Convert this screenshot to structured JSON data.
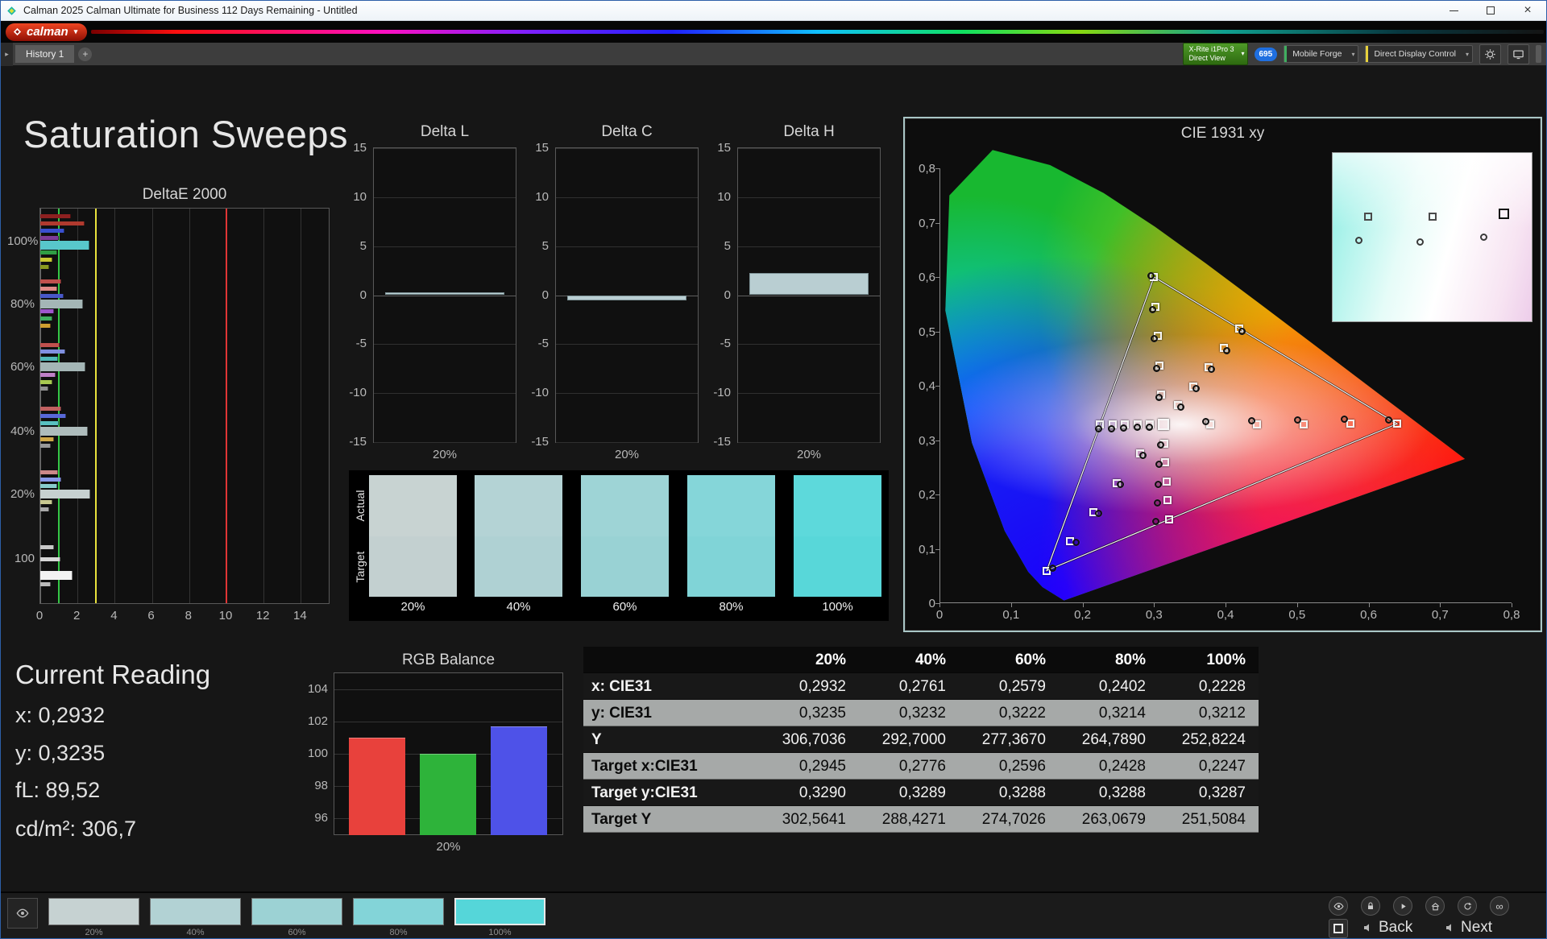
{
  "window": {
    "title": "Calman 2025 Calman Ultimate for Business 112 Days Remaining  - Untitled"
  },
  "brand": {
    "logo_text": "calman"
  },
  "toolbar": {
    "history_tab": "History 1",
    "meter": {
      "line1": "X-Rite i1Pro 3",
      "line2": "Direct View"
    },
    "badge": "695",
    "source": "Mobile Forge",
    "display": "Direct Display Control"
  },
  "page": {
    "title": "Saturation Sweeps"
  },
  "reading": {
    "title": "Current Reading",
    "lines": [
      "x: 0,2932",
      "y: 0,3235",
      "fL: 89,52",
      "cd/m²: 306,7"
    ]
  },
  "swatches": {
    "row_labels": [
      "Actual",
      "Target"
    ],
    "items": [
      {
        "label": "20%",
        "actual": "#c8d3d2",
        "target": "#c3d0d0"
      },
      {
        "label": "40%",
        "actual": "#b4d3d5",
        "target": "#afd1d3"
      },
      {
        "label": "60%",
        "actual": "#9ed4d6",
        "target": "#99d2d4"
      },
      {
        "label": "80%",
        "actual": "#85d6d9",
        "target": "#80d4d7"
      },
      {
        "label": "100%",
        "actual": "#5dd9db",
        "target": "#58d7d9"
      }
    ]
  },
  "table": {
    "headers": [
      "",
      "20%",
      "40%",
      "60%",
      "80%",
      "100%"
    ],
    "rows": [
      {
        "label": "x: CIE31",
        "values": [
          "0,2932",
          "0,2761",
          "0,2579",
          "0,2402",
          "0,2228"
        ]
      },
      {
        "label": "y: CIE31",
        "values": [
          "0,3235",
          "0,3232",
          "0,3222",
          "0,3214",
          "0,3212"
        ]
      },
      {
        "label": "Y",
        "values": [
          "306,7036",
          "292,7000",
          "277,3670",
          "264,7890",
          "252,8224"
        ]
      },
      {
        "label": "Target x:CIE31",
        "values": [
          "0,2945",
          "0,2776",
          "0,2596",
          "0,2428",
          "0,2247"
        ]
      },
      {
        "label": "Target y:CIE31",
        "values": [
          "0,3290",
          "0,3289",
          "0,3288",
          "0,3288",
          "0,3287"
        ]
      },
      {
        "label": "Target Y",
        "values": [
          "302,5641",
          "288,4271",
          "274,7026",
          "263,0679",
          "251,5084"
        ]
      }
    ]
  },
  "bottom": {
    "back": "Back",
    "next": "Next",
    "thumbnails": [
      {
        "label": "20%",
        "color": "#c6d2d2"
      },
      {
        "label": "40%",
        "color": "#b2d2d4"
      },
      {
        "label": "60%",
        "color": "#9cd2d4"
      },
      {
        "label": "80%",
        "color": "#83d4d8"
      },
      {
        "label": "100%",
        "color": "#55d6d9",
        "selected": true
      }
    ]
  },
  "chart_data": {
    "deltae2000": {
      "type": "bar",
      "title": "DeltaE 2000",
      "x_ticks": [
        0,
        2,
        4,
        6,
        8,
        10,
        12,
        14
      ],
      "x_max": 15.5,
      "y_groups": [
        "100%",
        "80%",
        "60%",
        "40%",
        "20%",
        "100"
      ],
      "group_fracs": [
        0.085,
        0.245,
        0.405,
        0.5675,
        0.7275,
        0.89
      ],
      "ref_lines": [
        {
          "v": 1,
          "color": "#35c746"
        },
        {
          "v": 3,
          "color": "#e8e23c"
        },
        {
          "v": 10,
          "color": "#e03535"
        }
      ],
      "bars": [
        {
          "y": 0.02,
          "v": 1.6,
          "c": "#8e2020"
        },
        {
          "y": 0.038,
          "v": 2.35,
          "c": "#b03a2e"
        },
        {
          "y": 0.056,
          "v": 1.25,
          "c": "#3a50d0"
        },
        {
          "y": 0.074,
          "v": 0.95,
          "c": "#7d3c98"
        },
        {
          "y": 0.092,
          "v": 2.6,
          "c": "#58c7cb",
          "t": 1
        },
        {
          "y": 0.112,
          "v": 0.85,
          "c": "#2f9e44"
        },
        {
          "y": 0.13,
          "v": 0.6,
          "c": "#c8c832"
        },
        {
          "y": 0.148,
          "v": 0.45,
          "c": "#8a9a20"
        },
        {
          "y": 0.185,
          "v": 1.1,
          "c": "#c0504d"
        },
        {
          "y": 0.203,
          "v": 0.85,
          "c": "#e08a87"
        },
        {
          "y": 0.221,
          "v": 1.2,
          "c": "#4858c8"
        },
        {
          "y": 0.241,
          "v": 2.25,
          "c": "#a4b6b6",
          "t": 1
        },
        {
          "y": 0.261,
          "v": 0.7,
          "c": "#9e55cc"
        },
        {
          "y": 0.279,
          "v": 0.6,
          "c": "#3fae5f"
        },
        {
          "y": 0.297,
          "v": 0.5,
          "c": "#cf9f30"
        },
        {
          "y": 0.345,
          "v": 1.0,
          "c": "#c0504d"
        },
        {
          "y": 0.363,
          "v": 1.3,
          "c": "#8090e0"
        },
        {
          "y": 0.381,
          "v": 0.9,
          "c": "#50b8b8"
        },
        {
          "y": 0.401,
          "v": 2.4,
          "c": "#a4b6b6",
          "t": 1
        },
        {
          "y": 0.421,
          "v": 0.8,
          "c": "#c080c8"
        },
        {
          "y": 0.439,
          "v": 0.6,
          "c": "#a8c850"
        },
        {
          "y": 0.457,
          "v": 0.4,
          "c": "#909090"
        },
        {
          "y": 0.508,
          "v": 1.1,
          "c": "#c06060"
        },
        {
          "y": 0.526,
          "v": 1.35,
          "c": "#5868d8"
        },
        {
          "y": 0.544,
          "v": 0.95,
          "c": "#58c0c0"
        },
        {
          "y": 0.564,
          "v": 2.5,
          "c": "#aebcbc",
          "t": 1
        },
        {
          "y": 0.584,
          "v": 0.7,
          "c": "#d0a848"
        },
        {
          "y": 0.602,
          "v": 0.5,
          "c": "#989898"
        },
        {
          "y": 0.668,
          "v": 0.9,
          "c": "#cc8888"
        },
        {
          "y": 0.686,
          "v": 1.1,
          "c": "#8898e8"
        },
        {
          "y": 0.704,
          "v": 0.85,
          "c": "#88cccc"
        },
        {
          "y": 0.724,
          "v": 2.65,
          "c": "#c6d0d0",
          "t": 1
        },
        {
          "y": 0.744,
          "v": 0.6,
          "c": "#c8c890"
        },
        {
          "y": 0.762,
          "v": 0.45,
          "c": "#a8a8a8"
        },
        {
          "y": 0.858,
          "v": 0.7,
          "c": "#c8c8c8"
        },
        {
          "y": 0.888,
          "v": 1.05,
          "c": "#d8d8d8"
        },
        {
          "y": 0.93,
          "v": 1.7,
          "c": "#f2f2f2",
          "t": 1
        },
        {
          "y": 0.952,
          "v": 0.5,
          "c": "#bbbbbb"
        }
      ]
    },
    "delta_l": {
      "type": "bar",
      "title": "Delta L",
      "value": 0.3,
      "ticks": [
        15,
        10,
        5,
        0,
        -5,
        -10,
        -15
      ],
      "x_label": "20%"
    },
    "delta_c": {
      "type": "bar",
      "title": "Delta C",
      "value": -0.5,
      "ticks": [
        15,
        10,
        5,
        0,
        -5,
        -10,
        -15
      ],
      "x_label": "20%"
    },
    "delta_h": {
      "type": "bar",
      "title": "Delta H",
      "value": 2.3,
      "ticks": [
        15,
        10,
        5,
        0,
        -5,
        -10,
        -15
      ],
      "x_label": "20%"
    },
    "rgb_balance": {
      "type": "bar",
      "title": "RGB Balance",
      "x_label": "20%",
      "y_ticks": [
        104,
        102,
        100,
        98,
        96
      ],
      "y_range": [
        95,
        105
      ],
      "series": [
        {
          "name": "Red",
          "value": 101.0,
          "color": "#e8413c"
        },
        {
          "name": "Green",
          "value": 100.0,
          "color": "#2eb33a"
        },
        {
          "name": "Blue",
          "value": 101.7,
          "color": "#4e52e8"
        }
      ]
    },
    "cie": {
      "type": "scatter",
      "title": "CIE 1931 xy",
      "x_range": [
        0,
        0.8
      ],
      "y_range": [
        0,
        0.8
      ],
      "x_tick_labels": [
        "0",
        "0,1",
        "0,2",
        "0,3",
        "0,4",
        "0,5",
        "0,6",
        "0,7",
        "0,8"
      ],
      "y_tick_labels": [
        "0",
        "0,1",
        "0,2",
        "0,3",
        "0,4",
        "0,5",
        "0,6",
        "0,7",
        "0,8"
      ],
      "white_point": [
        0.3127,
        0.329
      ],
      "triangle": [
        [
          0.64,
          0.33
        ],
        [
          0.3,
          0.6
        ],
        [
          0.15,
          0.06
        ]
      ],
      "locus": [
        [
          0.1741,
          0.005
        ],
        [
          0.144,
          0.0297
        ],
        [
          0.1241,
          0.0578
        ],
        [
          0.0913,
          0.1327
        ],
        [
          0.0454,
          0.295
        ],
        [
          0.0082,
          0.5384
        ],
        [
          0.0139,
          0.7502
        ],
        [
          0.0743,
          0.8338
        ],
        [
          0.1547,
          0.8059
        ],
        [
          0.2296,
          0.7543
        ],
        [
          0.3016,
          0.6923
        ],
        [
          0.3731,
          0.6245
        ],
        [
          0.4441,
          0.5547
        ],
        [
          0.5125,
          0.4866
        ],
        [
          0.5752,
          0.4242
        ],
        [
          0.627,
          0.3725
        ],
        [
          0.6915,
          0.3083
        ],
        [
          0.7347,
          0.2653
        ]
      ],
      "targets": [
        [
          0.3782,
          0.3292
        ],
        [
          0.4436,
          0.3294
        ],
        [
          0.5091,
          0.3296
        ],
        [
          0.5745,
          0.3298
        ],
        [
          0.64,
          0.33
        ],
        [
          0.3102,
          0.3832
        ],
        [
          0.3076,
          0.4374
        ],
        [
          0.3051,
          0.4916
        ],
        [
          0.3025,
          0.5458
        ],
        [
          0.3,
          0.6
        ],
        [
          0.2802,
          0.2752
        ],
        [
          0.2476,
          0.2214
        ],
        [
          0.2151,
          0.1676
        ],
        [
          0.1825,
          0.1138
        ],
        [
          0.15,
          0.06
        ],
        [
          0.2945,
          0.329
        ],
        [
          0.2776,
          0.3289
        ],
        [
          0.2596,
          0.3288
        ],
        [
          0.2428,
          0.3288
        ],
        [
          0.2247,
          0.3287
        ],
        [
          0.334,
          0.364
        ],
        [
          0.3553,
          0.3992
        ],
        [
          0.3766,
          0.4344
        ],
        [
          0.3979,
          0.4696
        ],
        [
          0.4192,
          0.5048
        ],
        [
          0.3143,
          0.294
        ],
        [
          0.316,
          0.259
        ],
        [
          0.3176,
          0.224
        ],
        [
          0.3193,
          0.189
        ],
        [
          0.3209,
          0.154
        ]
      ],
      "measured": [
        [
          0.2932,
          0.3235
        ],
        [
          0.2761,
          0.3232
        ],
        [
          0.2579,
          0.3222
        ],
        [
          0.2402,
          0.3214
        ],
        [
          0.2228,
          0.3212
        ],
        [
          0.372,
          0.334
        ],
        [
          0.437,
          0.336
        ],
        [
          0.501,
          0.337
        ],
        [
          0.566,
          0.338
        ],
        [
          0.628,
          0.337
        ],
        [
          0.3065,
          0.379
        ],
        [
          0.3035,
          0.432
        ],
        [
          0.3005,
          0.486
        ],
        [
          0.2975,
          0.54
        ],
        [
          0.296,
          0.602
        ],
        [
          0.2845,
          0.272
        ],
        [
          0.2535,
          0.218
        ],
        [
          0.2225,
          0.165
        ],
        [
          0.1915,
          0.112
        ],
        [
          0.158,
          0.064
        ],
        [
          0.3375,
          0.361
        ],
        [
          0.359,
          0.395
        ],
        [
          0.3805,
          0.43
        ],
        [
          0.402,
          0.465
        ],
        [
          0.4235,
          0.5
        ],
        [
          0.3095,
          0.291
        ],
        [
          0.3075,
          0.255
        ],
        [
          0.306,
          0.219
        ],
        [
          0.3045,
          0.184
        ],
        [
          0.303,
          0.15
        ]
      ],
      "inset": {
        "squares": [
          [
            0.18,
            0.38
          ],
          [
            0.5,
            0.38
          ],
          [
            0.86,
            0.36
          ]
        ],
        "circles": [
          [
            0.13,
            0.52
          ],
          [
            0.44,
            0.53
          ],
          [
            0.76,
            0.5
          ]
        ]
      }
    }
  }
}
